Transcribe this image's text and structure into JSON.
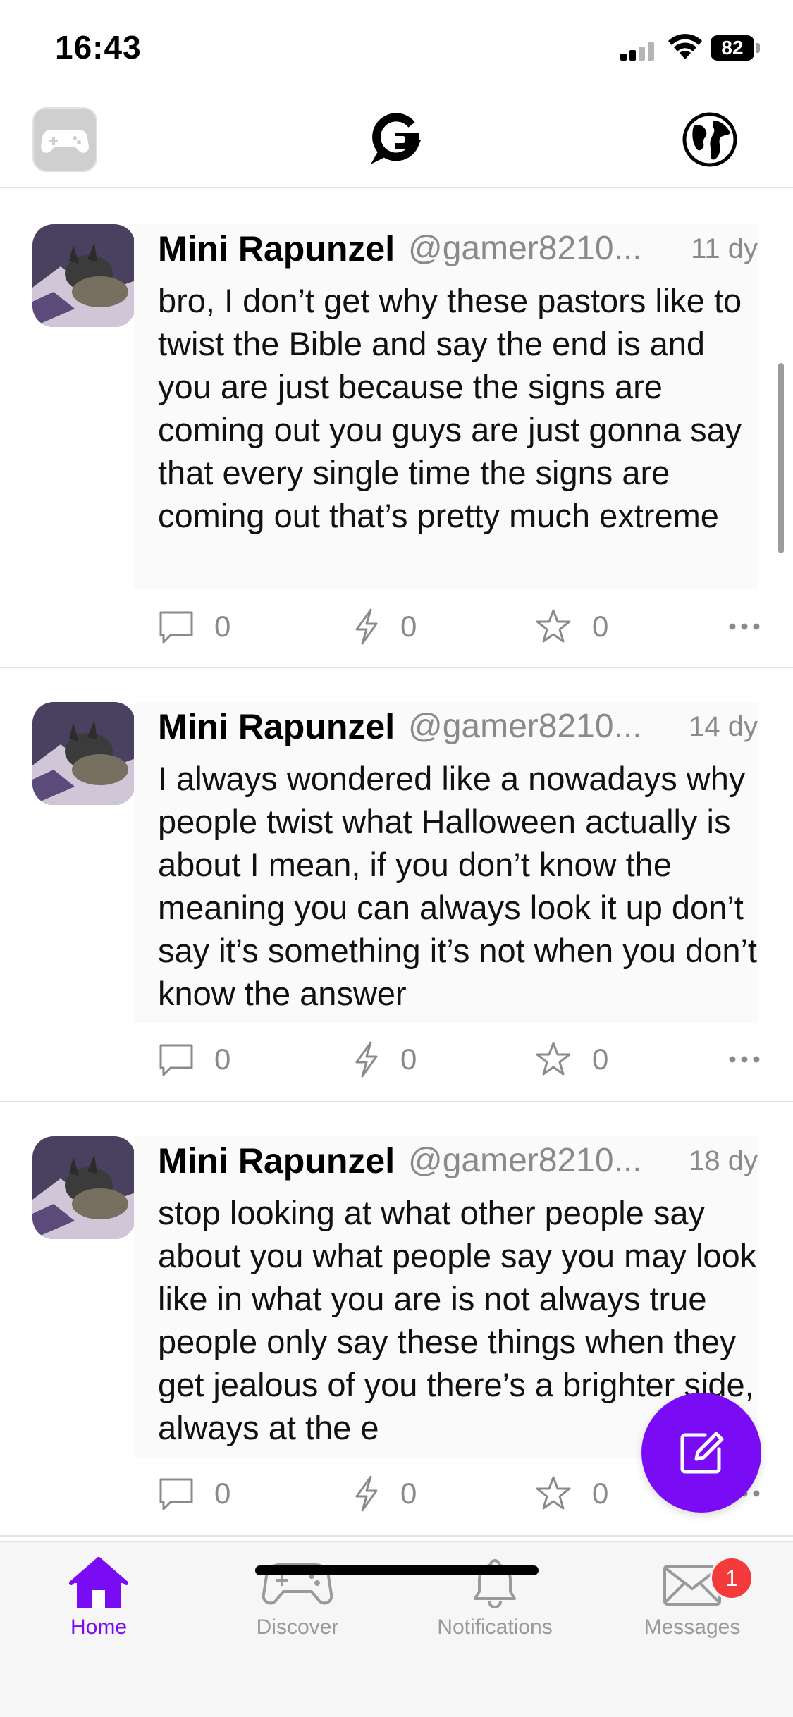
{
  "status_bar": {
    "time": "16:43",
    "battery": "82"
  },
  "top_nav": {
    "left_icon": "game-controller-icon",
    "center_icon": "app-logo",
    "right_icon": "globe-icon"
  },
  "posts": [
    {
      "author": "Mini Rapunzel",
      "handle": "@gamer8210...",
      "time": "11 dy",
      "text": "bro, I don’t get why these pastors like to twist the Bible and say the end is and you are just because the signs are coming out you guys are just gonna say that every single time the signs are coming out that’s pretty much extreme",
      "replies": "0",
      "boosts": "0",
      "likes": "0"
    },
    {
      "author": "Mini Rapunzel",
      "handle": "@gamer8210...",
      "time": "14 dy",
      "text": "I always wondered like a nowadays why people twist what Halloween actually is about I mean, if you don’t know the meaning you can always look it up don’t say it’s something it’s not when you don’t know the answer",
      "replies": "0",
      "boosts": "0",
      "likes": "0"
    },
    {
      "author": "Mini Rapunzel",
      "handle": "@gamer8210...",
      "time": "18 dy",
      "text": "stop looking at what other people say about you what people say you may look like in what you are is not always true people only say these things when they get jealous of you there’s a brighter side, always at the e",
      "replies": "0",
      "boosts": "0",
      "likes": "0"
    }
  ],
  "tabs": [
    {
      "label": "Home",
      "icon": "home-icon",
      "active": true
    },
    {
      "label": "Discover",
      "icon": "game-controller-icon"
    },
    {
      "label": "Notifications",
      "icon": "bell-icon"
    },
    {
      "label": "Messages",
      "icon": "envelope-icon",
      "badge": "1"
    }
  ],
  "colors": {
    "accent": "#7a0cf5",
    "badge": "#f43a3a",
    "muted": "#8a8a8a"
  }
}
